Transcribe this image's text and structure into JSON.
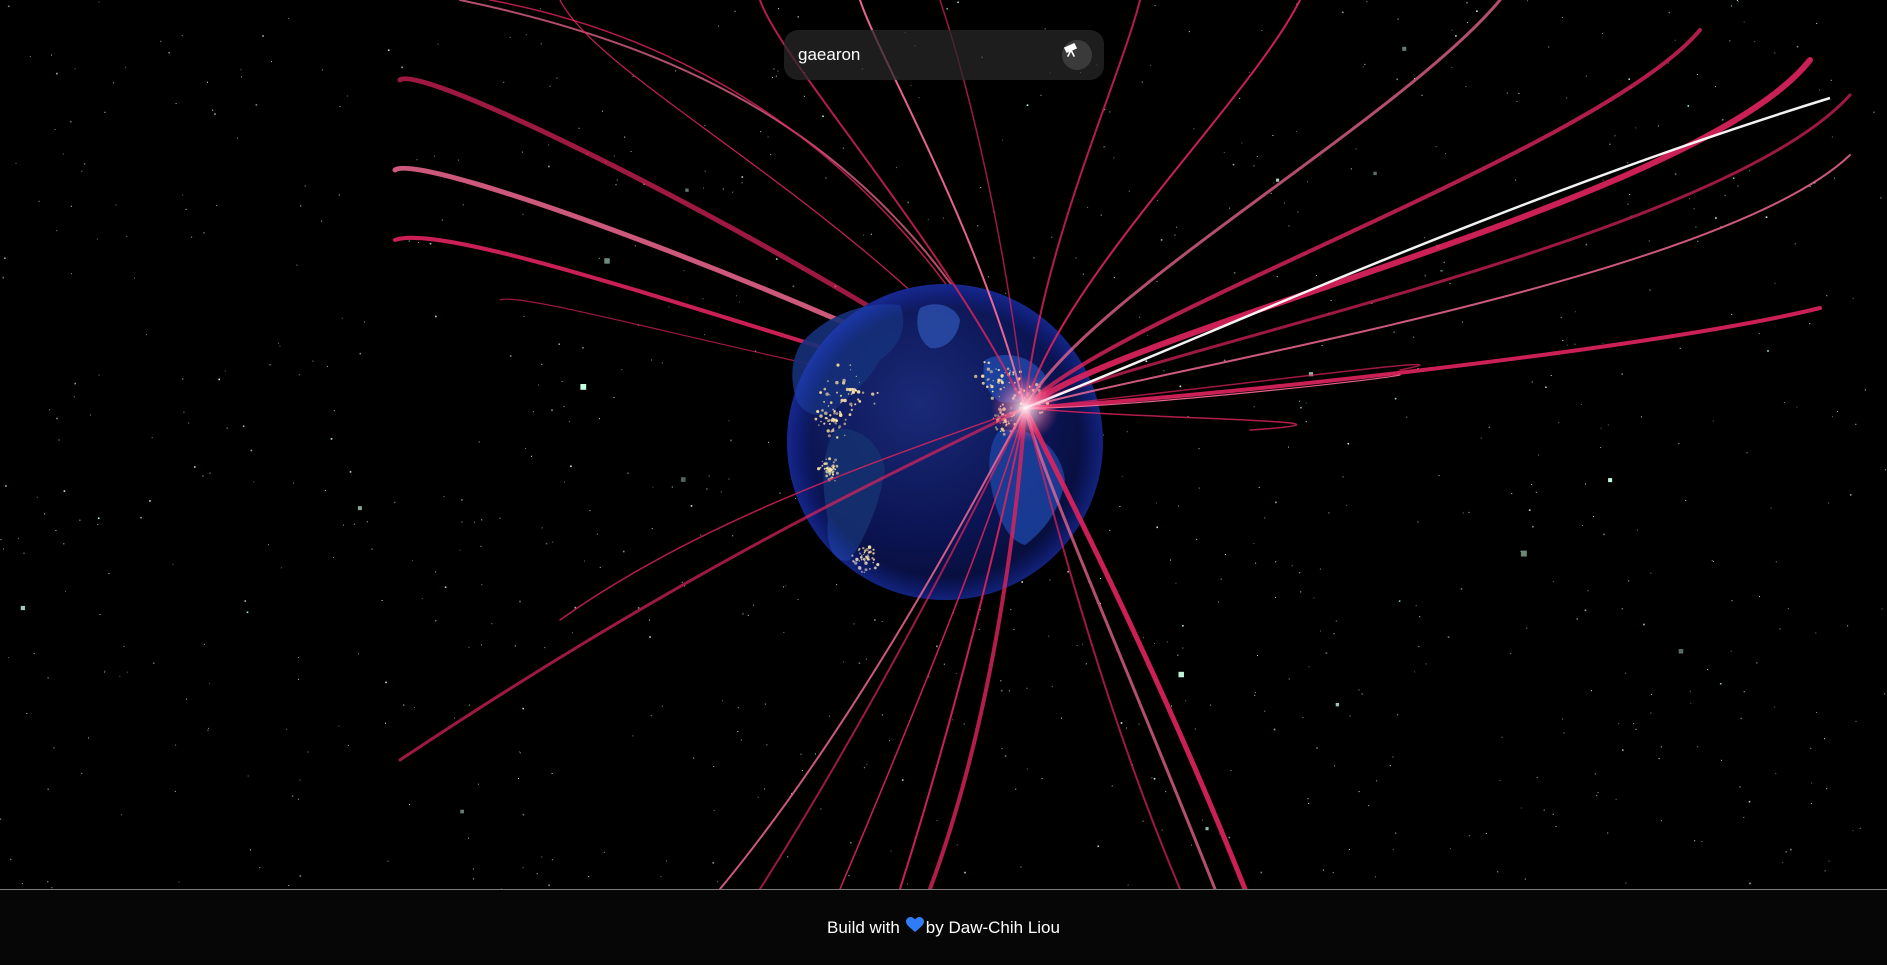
{
  "search": {
    "value": "gaearon",
    "button_icon": "telescope-icon"
  },
  "footer": {
    "prefix": "Build with",
    "heart_icon": "blue-heart-icon",
    "suffix": "by Daw-Chih Liou"
  },
  "colors": {
    "background": "#000000",
    "arc": "#e0245e",
    "arc_highlight": "#ff6f9a",
    "globe_ocean": "#0a1650",
    "globe_land": "#1b3a8c",
    "city_lights": "#ffe6a8",
    "star": "#c8ffe2",
    "heart": "#2f7cf6"
  }
}
